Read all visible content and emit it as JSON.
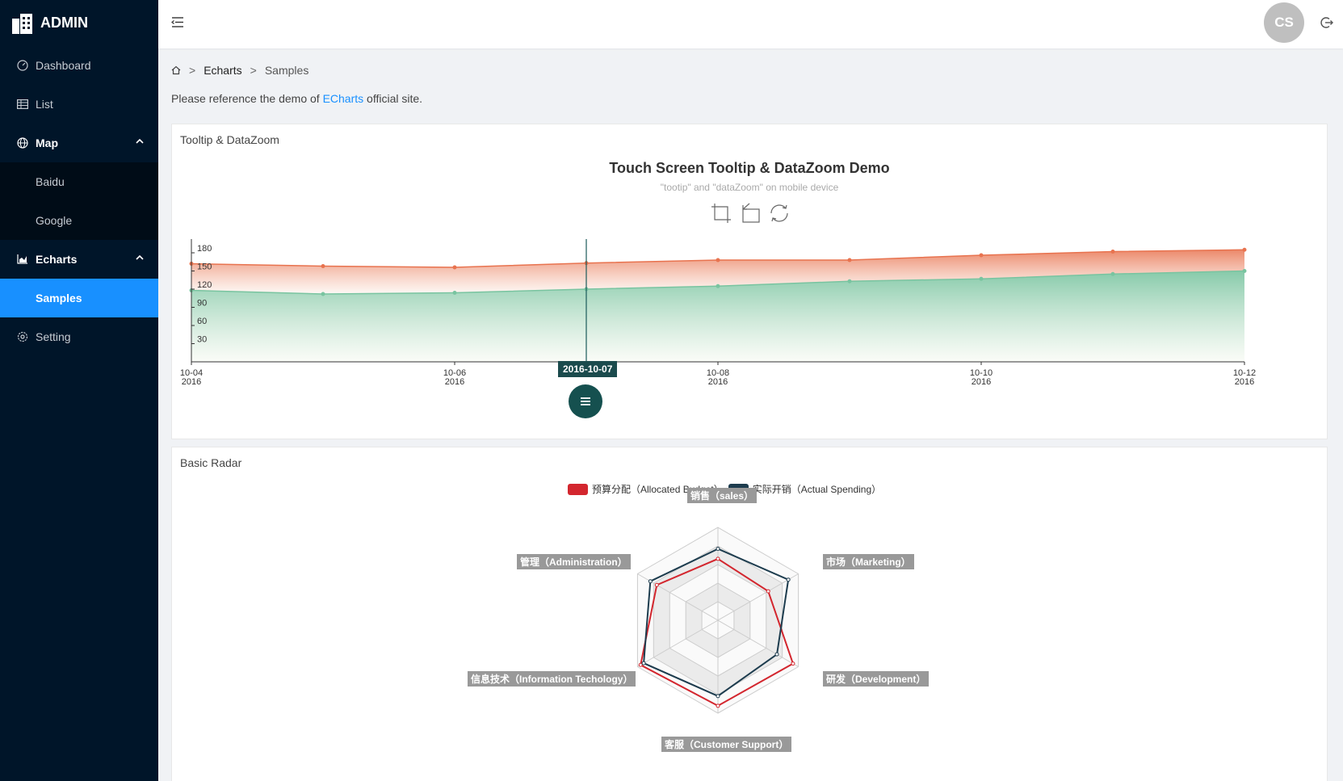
{
  "app": {
    "title": "ADMIN"
  },
  "sidebar": {
    "items": [
      {
        "label": "Dashboard",
        "icon": "dashboard-icon"
      },
      {
        "label": "List",
        "icon": "table-icon"
      },
      {
        "label": "Map",
        "icon": "globe-icon",
        "expanded": true
      },
      {
        "label": "Baidu"
      },
      {
        "label": "Google"
      },
      {
        "label": "Echarts",
        "icon": "area-chart-icon",
        "expanded": true
      },
      {
        "label": "Samples",
        "active": true
      },
      {
        "label": "Setting",
        "icon": "gear-icon"
      }
    ]
  },
  "header": {
    "avatar_initials": "CS"
  },
  "breadcrumb": {
    "items": [
      "Echarts",
      "Samples"
    ],
    "separator": ">"
  },
  "intro": {
    "prefix": "Please reference the demo of ",
    "link": "ECharts",
    "suffix": " official site."
  },
  "card1": {
    "title": "Tooltip & DataZoom",
    "chart_title": "Touch Screen Tooltip & DataZoom Demo",
    "chart_subtitle": "\"tootip\" and \"dataZoom\" on mobile device",
    "tooltip_label": "2016-10-07"
  },
  "card2": {
    "title": "Basic Radar",
    "legend": [
      "预算分配（Allocated Budget）",
      "实际开销（Actual Spending）"
    ],
    "indicators": [
      "销售（sales）",
      "市场（Marketing）",
      "研发（Development）",
      "客服（Customer Support）",
      "信息技术（Information Techology）",
      "管理（Administration）"
    ]
  },
  "colors": {
    "accent": "#1890ff",
    "sidebar_bg": "#001529",
    "series_top": "#e8734f",
    "series_bottom": "#79c4a0",
    "budget": "#d3262e",
    "spending": "#1d3c4e"
  },
  "chart_data": [
    {
      "type": "area",
      "x": [
        "2016-10-04",
        "2016-10-05",
        "2016-10-06",
        "2016-10-07",
        "2016-10-08",
        "2016-10-09",
        "2016-10-10",
        "2016-10-11",
        "2016-10-12"
      ],
      "x_tick_labels": [
        {
          "line1": "10-04",
          "line2": "2016"
        },
        {
          "line1": "10-06",
          "line2": "2016"
        },
        {
          "line1": "10-08",
          "line2": "2016"
        },
        {
          "line1": "10-10",
          "line2": "2016"
        },
        {
          "line1": "10-12",
          "line2": "2016"
        }
      ],
      "y_ticks": [
        30,
        60,
        90,
        120,
        150,
        180
      ],
      "ylim": [
        0,
        200
      ],
      "series": [
        {
          "values": [
            118,
            112,
            114,
            120,
            125,
            133,
            137,
            145,
            150
          ]
        },
        {
          "values": [
            162,
            158,
            156,
            163,
            168,
            168,
            176,
            182,
            185
          ]
        }
      ],
      "tooltip_x": "2016-10-07"
    },
    {
      "type": "radar",
      "indicators": [
        {
          "name": "销售（sales）",
          "max": 6500
        },
        {
          "name": "市场（Marketing）",
          "max": 16000
        },
        {
          "name": "研发（Development）",
          "max": 30000
        },
        {
          "name": "客服（Customer Support）",
          "max": 38000
        },
        {
          "name": "信息技术（Information Techology）",
          "max": 52000
        },
        {
          "name": "管理（Administration）",
          "max": 25000
        }
      ],
      "series": [
        {
          "name": "预算分配（Allocated Budget）",
          "values": [
            4300,
            10000,
            28000,
            35000,
            50000,
            19000
          ]
        },
        {
          "name": "实际开销（Actual Spending）",
          "values": [
            5000,
            14000,
            22000,
            31000,
            48000,
            21000
          ]
        }
      ]
    }
  ]
}
